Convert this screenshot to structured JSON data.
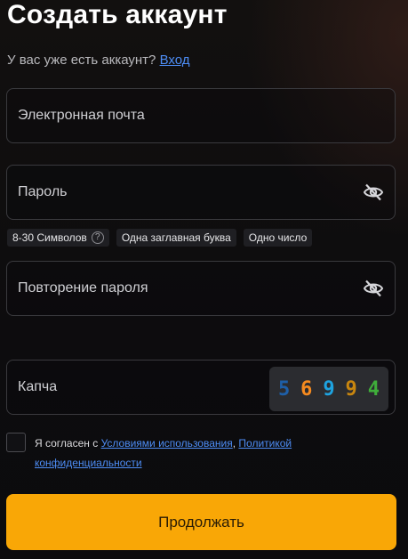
{
  "title": "Создать аккаунт",
  "subtitle": {
    "text": "У вас уже есть аккаунт?",
    "login_link": "Вход"
  },
  "fields": {
    "email": {
      "placeholder": "Электронная почта"
    },
    "password": {
      "placeholder": "Пароль",
      "icon": "eye-off-icon"
    },
    "password_repeat": {
      "placeholder": "Повторение пароля",
      "icon": "eye-off-icon"
    },
    "captcha": {
      "placeholder": "Капча",
      "digits": [
        "5",
        "6",
        "9",
        "9",
        "4"
      ],
      "digit_colors": [
        "#1e5fa8",
        "#f58a1f",
        "#1ea3e0",
        "#c8860f",
        "#3fae3a"
      ]
    }
  },
  "password_requirements": [
    {
      "label": "8-30 Символов",
      "help": "?"
    },
    {
      "label": "Одна заглавная буква"
    },
    {
      "label": "Одно число"
    }
  ],
  "agreement": {
    "prefix": "Я согласен с ",
    "terms_link": "Условиями использования",
    "separator": ", ",
    "privacy_link": "Политикой конфиденциальности"
  },
  "submit_label": "Продолжать",
  "colors": {
    "accent": "#f9a706",
    "link": "#4d8df5",
    "border": "#3a3a3e"
  }
}
